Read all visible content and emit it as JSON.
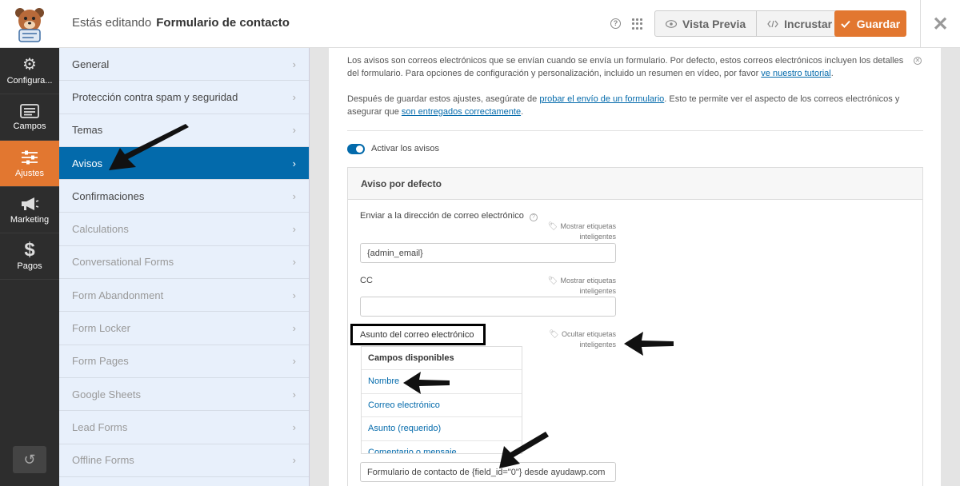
{
  "header": {
    "editing_prefix": "Estás editando",
    "form_name": "Formulario de contacto",
    "help_icon": "question-circle-icon",
    "grid_icon": "grid-icon",
    "preview_label": "Vista Previa",
    "embed_label": "Incrustar",
    "save_label": "Guardar",
    "accent_color": "#e27730"
  },
  "leftnav": {
    "items": [
      {
        "label": "Configura...",
        "icon": "gear-icon"
      },
      {
        "label": "Campos",
        "icon": "fields-icon"
      },
      {
        "label": "Ajustes",
        "icon": "sliders-icon"
      },
      {
        "label": "Marketing",
        "icon": "megaphone-icon"
      },
      {
        "label": "Pagos",
        "icon": "dollar-icon"
      }
    ],
    "active": "Ajustes"
  },
  "settings_menu": {
    "items": [
      {
        "label": "General",
        "state": "enabled"
      },
      {
        "label": "Protección contra spam y seguridad",
        "state": "enabled"
      },
      {
        "label": "Temas",
        "state": "enabled"
      },
      {
        "label": "Avisos",
        "state": "active"
      },
      {
        "label": "Confirmaciones",
        "state": "enabled"
      },
      {
        "label": "Calculations",
        "state": "disabled"
      },
      {
        "label": "Conversational Forms",
        "state": "disabled"
      },
      {
        "label": "Form Abandonment",
        "state": "disabled"
      },
      {
        "label": "Form Locker",
        "state": "disabled"
      },
      {
        "label": "Form Pages",
        "state": "disabled"
      },
      {
        "label": "Google Sheets",
        "state": "disabled"
      },
      {
        "label": "Lead Forms",
        "state": "disabled"
      },
      {
        "label": "Offline Forms",
        "state": "disabled"
      }
    ],
    "active_color": "#036aab"
  },
  "notice": {
    "p1_text": "Los avisos son correos electrónicos que se envían cuando se envía un formulario. Por defecto, estos correos electrónicos incluyen los detalles del formulario. Para opciones de configuración y personalización, incluido un resumen en vídeo, por favor ",
    "p1_link": "ve nuestro tutorial",
    "p1_end": ".",
    "p2_text": "Después de guardar estos ajustes, asegúrate de ",
    "p2_link1": "probar el envío de un formulario",
    "p2_mid": ". Esto te permite ver el aspecto de los correos electrónicos y asegurar que ",
    "p2_link2": "son entregados correctamente",
    "p2_end": "."
  },
  "toggle": {
    "label": "Activar los avisos",
    "on": true
  },
  "notification": {
    "title": "Aviso por defecto",
    "send_to_label": "Enviar a la dirección de correo electrónico",
    "send_to_value": "{admin_email}",
    "show_smart_tags": "Mostrar etiquetas inteligentes",
    "cc_label": "CC",
    "cc_value": "",
    "subject_label": "Asunto del correo electrónico",
    "hide_smart_tags": "Ocultar etiquetas inteligentes",
    "dropdown_title": "Campos disponibles",
    "fields": [
      "Nombre",
      "Correo electrónico",
      "Asunto (requerido)",
      "Comentario o mensaje"
    ],
    "subject_value": "Formulario de contacto de {field_id=\"0\"} desde ayudawp.com"
  }
}
